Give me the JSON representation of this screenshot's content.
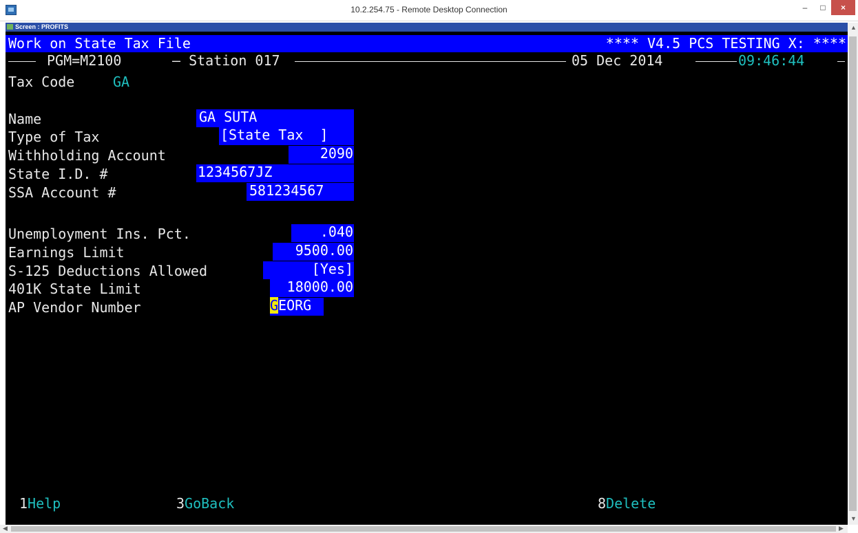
{
  "window": {
    "title": "10.2.254.75 - Remote Desktop Connection",
    "minimize": "–",
    "maximize": "□",
    "close": "×"
  },
  "screen_label": "Screen : PROFITS",
  "terminal": {
    "header_left": "Work on State Tax File",
    "header_right": "**** V4.5 PCS TESTING X: ****",
    "pgm": "PGM=M2100",
    "station": "– Station 017",
    "date": "05 Dec 2014",
    "time": "09:46:44",
    "tax_code_label": "Tax Code",
    "tax_code_value": "GA",
    "fields": [
      {
        "label": "Name",
        "value": "GA SUTA"
      },
      {
        "label": "Type of Tax",
        "value": "[State Tax  ]"
      },
      {
        "label": "Withholding Account",
        "value": "2090"
      },
      {
        "label": "State I.D. #",
        "value": "1234567JZ"
      },
      {
        "label": "SSA Account #",
        "value": "581234567"
      },
      {
        "label": "Unemployment Ins. Pct.",
        "value": ".040"
      },
      {
        "label": "Earnings Limit",
        "value": "9500.00"
      },
      {
        "label": "S-125 Deductions Allowed",
        "value": "[Yes]"
      },
      {
        "label": "401K State Limit",
        "value": "18000.00"
      },
      {
        "label": "AP Vendor Number",
        "value_cursor": "G",
        "value_rest": "EORG"
      }
    ],
    "fkeys": [
      {
        "num": "1",
        "label": "Help"
      },
      {
        "num": "3",
        "label": "GoBack"
      },
      {
        "num": "8",
        "label": "Delete"
      }
    ]
  },
  "colors": {
    "field_bg": "#0000ff",
    "accent_cyan": "#1fbfbf",
    "cursor": "#f2e80c",
    "close_button": "#c7504b"
  }
}
